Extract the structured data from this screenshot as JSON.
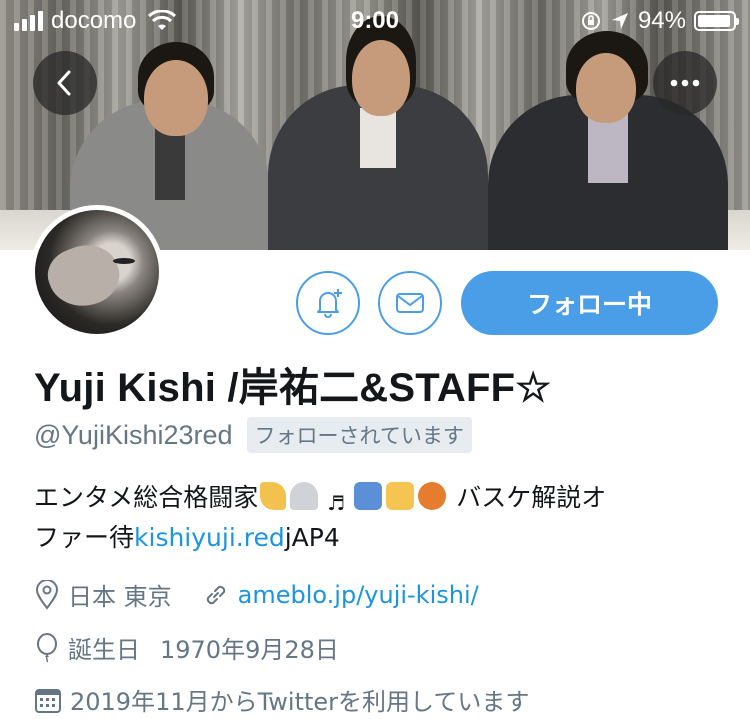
{
  "status_bar": {
    "carrier": "docomo",
    "time": "9:00",
    "battery_percent": "94%",
    "battery_level": 0.94
  },
  "nav": {
    "back_icon": "chevron-left-icon",
    "more_icon": "ellipsis-icon"
  },
  "actions": {
    "notify_icon": "bell-plus-icon",
    "message_icon": "envelope-icon",
    "follow_label": "フォロー中"
  },
  "profile": {
    "name": "Yuji Kishi /岸祐二&STAFF☆",
    "handle": "@YujiKishi23red",
    "follows_you": "フォローされています",
    "bio_line1": "エンタメ総合格闘家",
    "bio_line1_tail": "バスケ解説オ",
    "bio_line2_prefix": "ファー待",
    "bio_link": "kishiyuji.red",
    "bio_line2_suffix": "jAP4",
    "location": "日本 東京",
    "website": "ameblo.jp/yuji-kishi/",
    "birth_label": "誕生日",
    "birth_date": "1970年9月28日",
    "joined": "2019年11月からTwitterを利用しています"
  },
  "colors": {
    "accent": "#4a9ee8",
    "link": "#1b95e0",
    "secondary_text": "#657786",
    "badge_bg": "#e6ecf0"
  }
}
